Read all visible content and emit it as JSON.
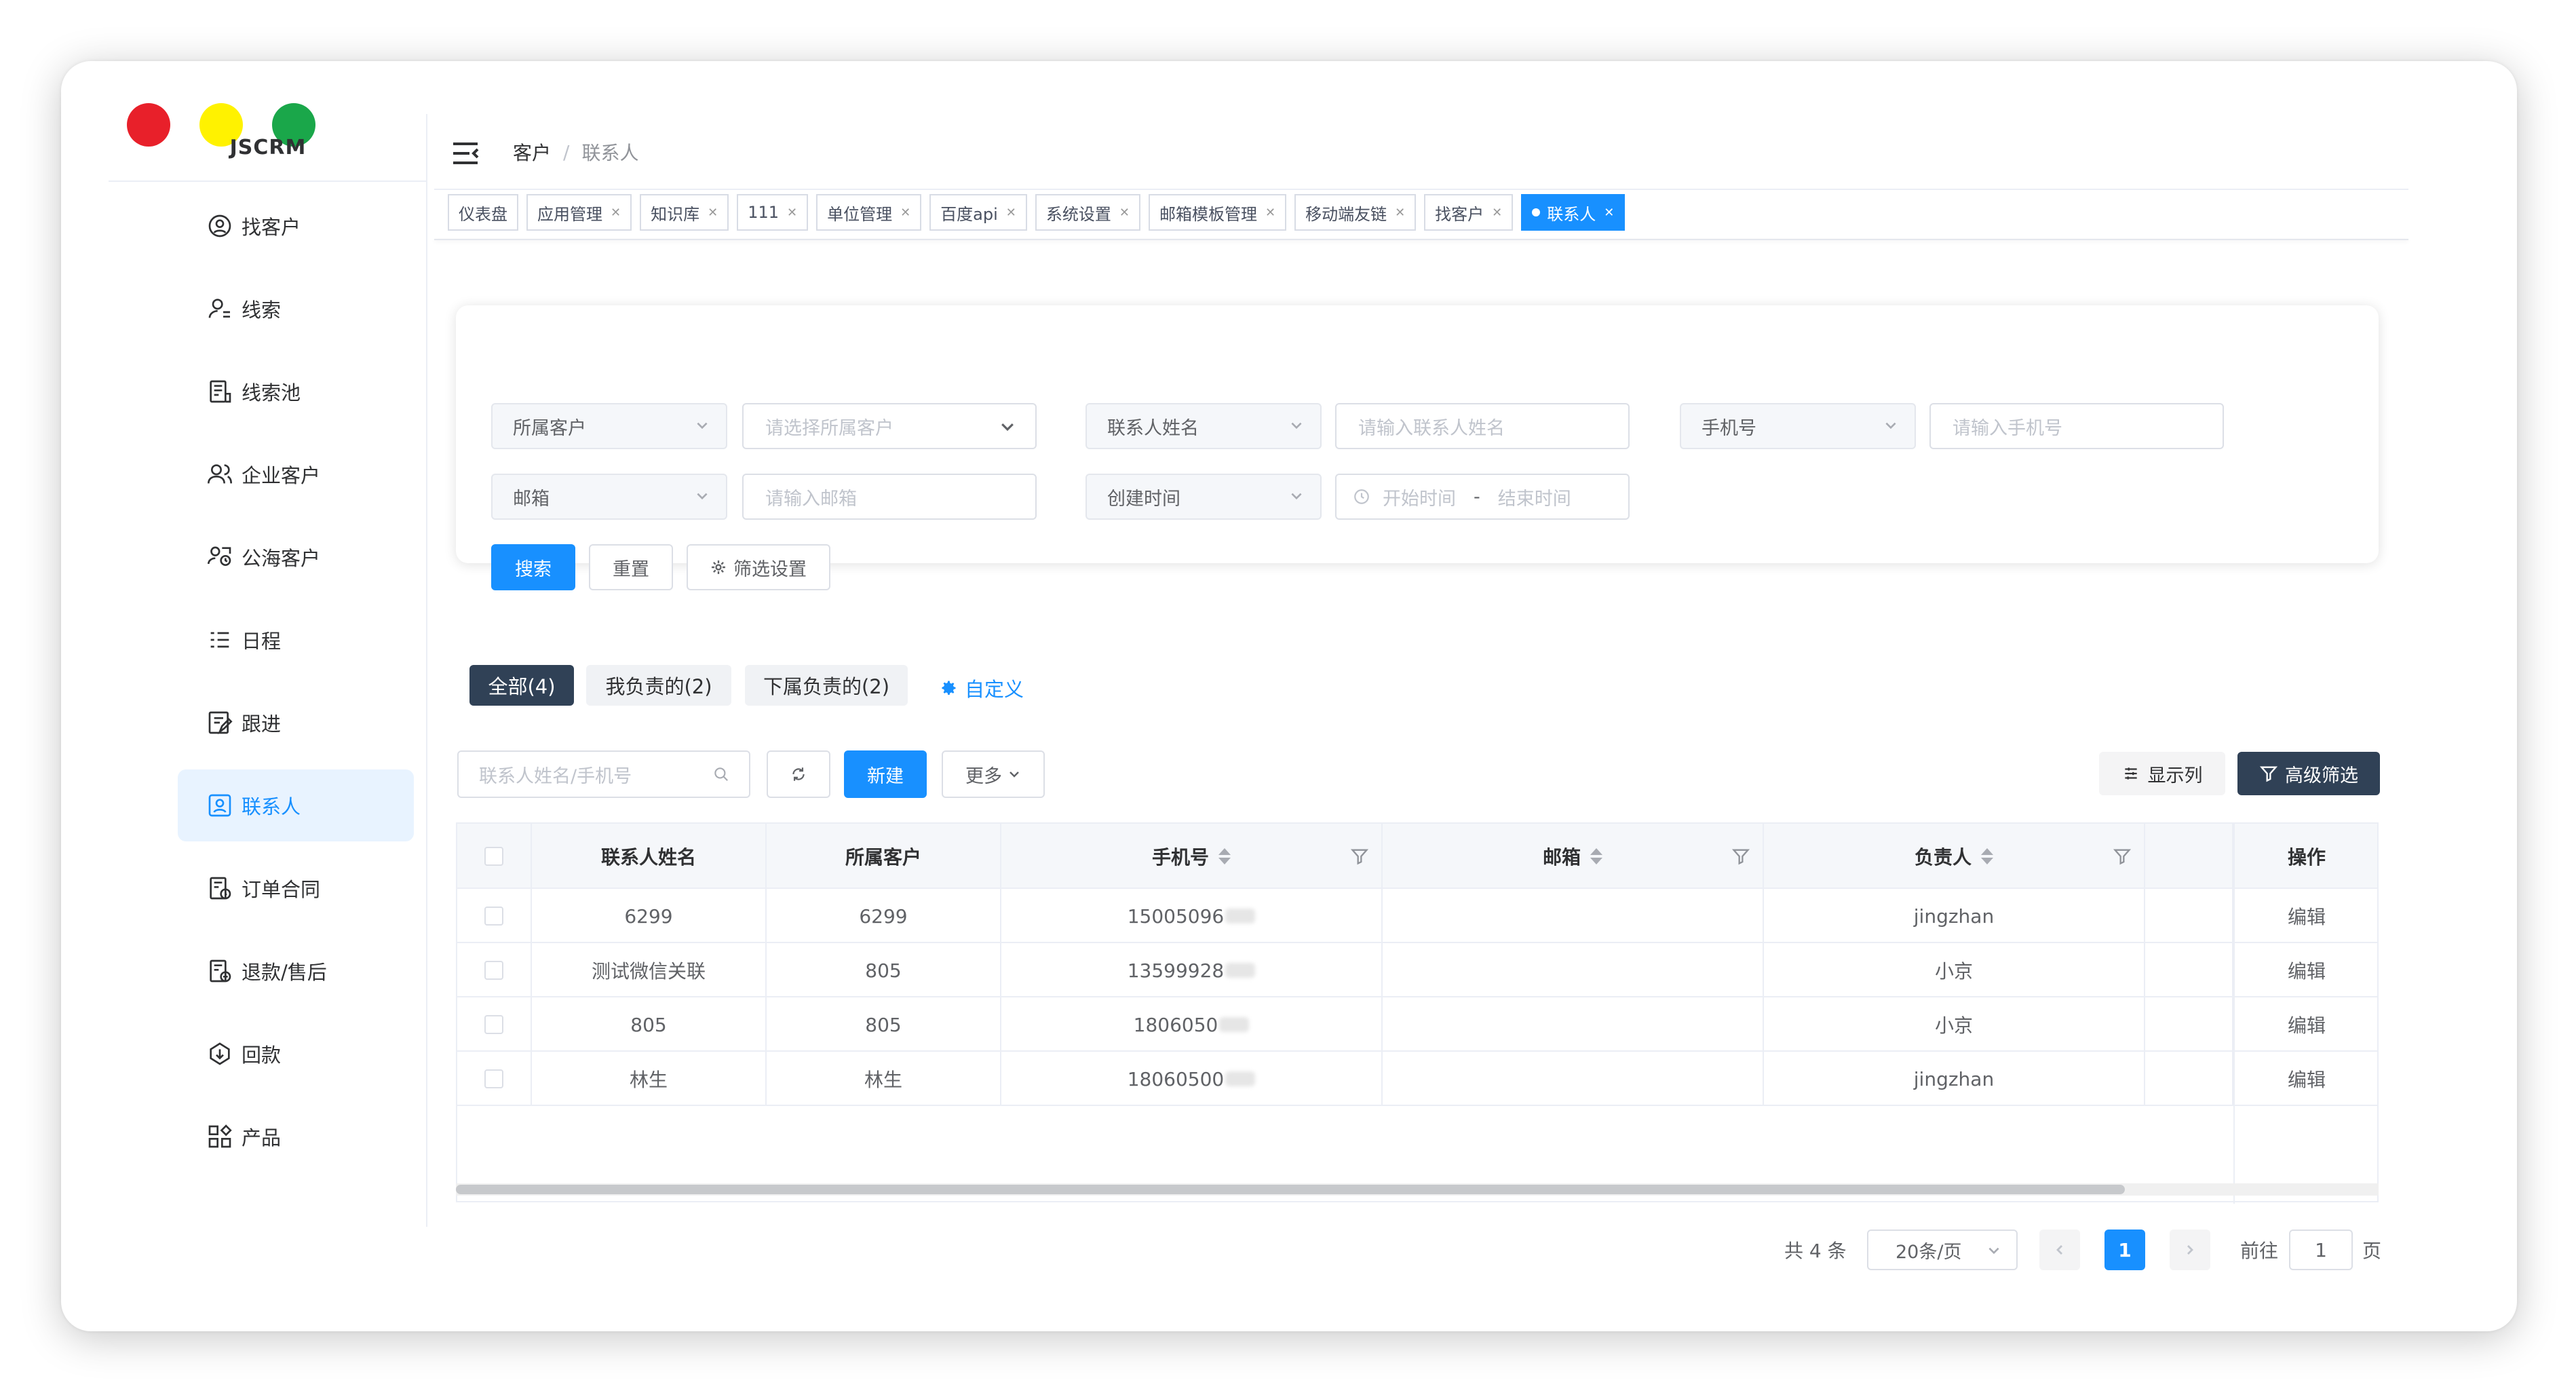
{
  "app": {
    "logo": "JSCRM"
  },
  "sidebar": {
    "items": [
      {
        "label": "找客户",
        "icon": "find-customer-icon"
      },
      {
        "label": "线索",
        "icon": "lead-icon"
      },
      {
        "label": "线索池",
        "icon": "lead-pool-icon"
      },
      {
        "label": "企业客户",
        "icon": "enterprise-customer-icon"
      },
      {
        "label": "公海客户",
        "icon": "public-customer-icon"
      },
      {
        "label": "日程",
        "icon": "schedule-icon"
      },
      {
        "label": "跟进",
        "icon": "follow-up-icon"
      },
      {
        "label": "联系人",
        "icon": "contact-icon",
        "active": true
      },
      {
        "label": "订单合同",
        "icon": "order-contract-icon"
      },
      {
        "label": "退款/售后",
        "icon": "refund-icon"
      },
      {
        "label": "回款",
        "icon": "payment-icon"
      },
      {
        "label": "产品",
        "icon": "product-icon"
      }
    ]
  },
  "breadcrumb": {
    "parent": "客户",
    "separator": "/",
    "current": "联系人"
  },
  "tags": [
    "仪表盘",
    "应用管理",
    "知识库",
    "111",
    "单位管理",
    "百度api",
    "系统设置",
    "邮箱模板管理",
    "移动端友链",
    "找客户",
    "联系人"
  ],
  "filters": {
    "customer_field": "所属客户",
    "customer_placeholder": "请选择所属客户",
    "name_field": "联系人姓名",
    "name_placeholder": "请输入联系人姓名",
    "phone_field": "手机号",
    "phone_placeholder": "请输入手机号",
    "email_field": "邮箱",
    "email_placeholder": "请输入邮箱",
    "time_field": "创建时间",
    "start_placeholder": "开始时间",
    "range_sep": "-",
    "end_placeholder": "结束时间",
    "search_btn": "搜索",
    "reset_btn": "重置",
    "settings_btn": "筛选设置"
  },
  "scopes": {
    "all": "全部(4)",
    "mine": "我负责的(2)",
    "sub": "下属负责的(2)",
    "custom": "自定义"
  },
  "toolbar": {
    "search_placeholder": "联系人姓名/手机号",
    "new_btn": "新建",
    "more_btn": "更多",
    "columns_btn": "显示列",
    "advanced_btn": "高级筛选"
  },
  "table": {
    "headers": {
      "name": "联系人姓名",
      "customer": "所属客户",
      "phone": "手机号",
      "email": "邮箱",
      "owner": "负责人",
      "action": "操作"
    },
    "rows": [
      {
        "name": "6299",
        "customer": "6299",
        "phone": "15005096",
        "email": "",
        "owner": "jingzhan",
        "action": "编辑"
      },
      {
        "name": "测试微信关联",
        "customer": "805",
        "phone": "13599928",
        "email": "",
        "owner": "小京",
        "action": "编辑"
      },
      {
        "name": "805",
        "customer": "805",
        "phone": "1806050",
        "email": "",
        "owner": "小京",
        "action": "编辑"
      },
      {
        "name": "林生",
        "customer": "林生",
        "phone": "18060500",
        "email": "",
        "owner": "jingzhan",
        "action": "编辑"
      }
    ]
  },
  "pagination": {
    "total": "共 4 条",
    "size": "20条/页",
    "current": "1",
    "goto": "前往",
    "goto_value": "1",
    "page_suffix": "页"
  },
  "colors": {
    "primary": "#1890ff",
    "dark": "#304156",
    "active_bg": "#e8f3ff"
  }
}
